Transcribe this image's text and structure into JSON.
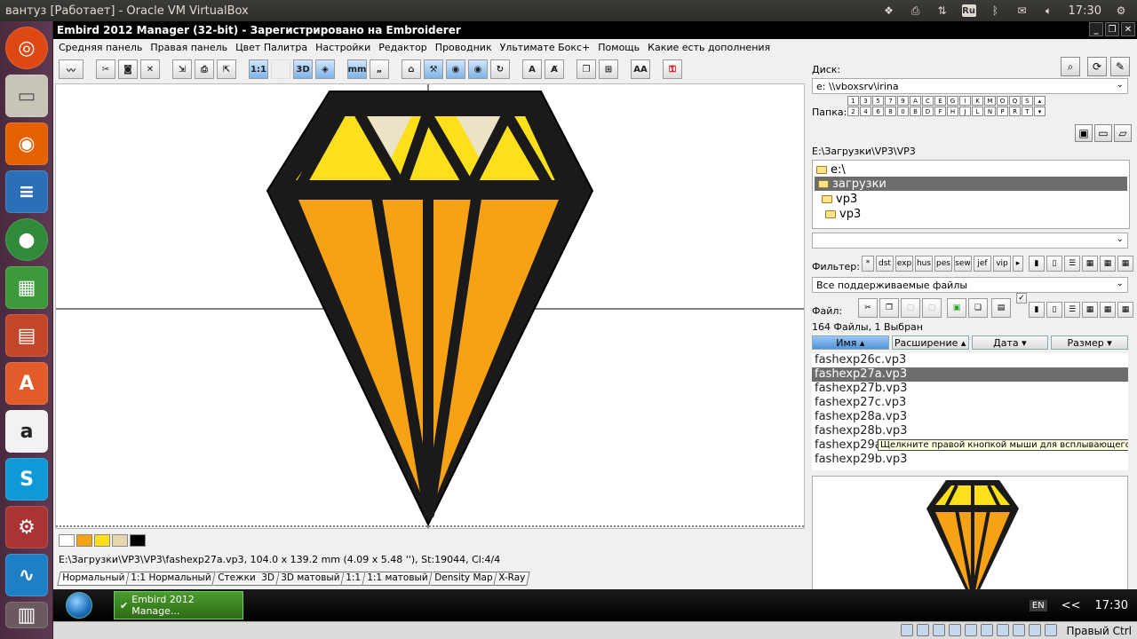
{
  "ubuntu": {
    "window_title": "вантуз [Работает] - Oracle VM VirtualBox",
    "lang": "Ru",
    "clock": "17:30"
  },
  "app": {
    "title": "Embird 2012 Manager (32-bit) - Зарегистрировано на Embroiderer",
    "menu": [
      "Средняя панель",
      "Правая панель",
      "Цвет Палитра",
      "Настройки",
      "Редактор",
      "Проводник",
      "Ультимате Бокс+",
      "Помощь",
      "Какие есть дополнения"
    ]
  },
  "toolbar": {
    "labels": [
      "1:1",
      "3D",
      "mm",
      "A",
      "AA"
    ]
  },
  "palette": {
    "colors": [
      "#ffffff",
      "#f7a214",
      "#fde01a",
      "#e6d7b0",
      "#000000"
    ]
  },
  "status": {
    "file_info": "E:\\Загрузки\\VP3\\VP3\\fashexp27a.vp3, 104.0 x 139.2 mm (4.09 x 5.48 ''), St:19044, Cl:4/4"
  },
  "view_tabs": [
    "Нормальный",
    "1:1 Нормальный",
    "Стежки",
    "3D",
    "3D матовый",
    "1:1",
    "1:1 матовый",
    "Density Map",
    "X-Ray"
  ],
  "right_panel": {
    "disk_label": "Диск:",
    "disk_value": "e: \\\\vboxsrv\\irina",
    "folder_label": "Папка:",
    "keys_row1": [
      "1",
      "3",
      "5",
      "7",
      "9",
      "A",
      "C",
      "E",
      "G",
      "I",
      "K",
      "M",
      "O",
      "Q",
      "S"
    ],
    "keys_row2": [
      "2",
      "4",
      "6",
      "8",
      "0",
      "B",
      "D",
      "F",
      "H",
      "J",
      "L",
      "N",
      "P",
      "R",
      "T"
    ],
    "path": "E:\\Загрузки\\VP3\\VP3",
    "tree": [
      "e:\\",
      "загрузки",
      "vp3",
      "vp3"
    ],
    "filter_label": "Фильтер:",
    "filter_buttons": [
      "*",
      "dst",
      "exp",
      "hus",
      "pes",
      "sew",
      "jef",
      "vip"
    ],
    "filter_combo": "Все поддерживаемые файлы",
    "file_label": "Файл:",
    "count": "164 Файлы, 1 Выбран",
    "columns": [
      "Имя ▴",
      "Расширение ▴",
      "Дата ▾",
      "Размер ▾"
    ],
    "files": [
      "fashexp26c.vp3",
      "fashexp27a.vp3",
      "fashexp27b.vp3",
      "fashexp27c.vp3",
      "fashexp28a.vp3",
      "fashexp28b.vp3",
      "fashexp29a",
      "fashexp29b.vp3"
    ],
    "tooltip": "Щелкните правой кнопкой мыши для всплывающего меню"
  },
  "taskbar": {
    "item": "Embird 2012 Manage...",
    "lang": "EN",
    "chevron": "<<",
    "clock": "17:30"
  },
  "vbox_status": {
    "host_key": "Правый Ctrl"
  }
}
